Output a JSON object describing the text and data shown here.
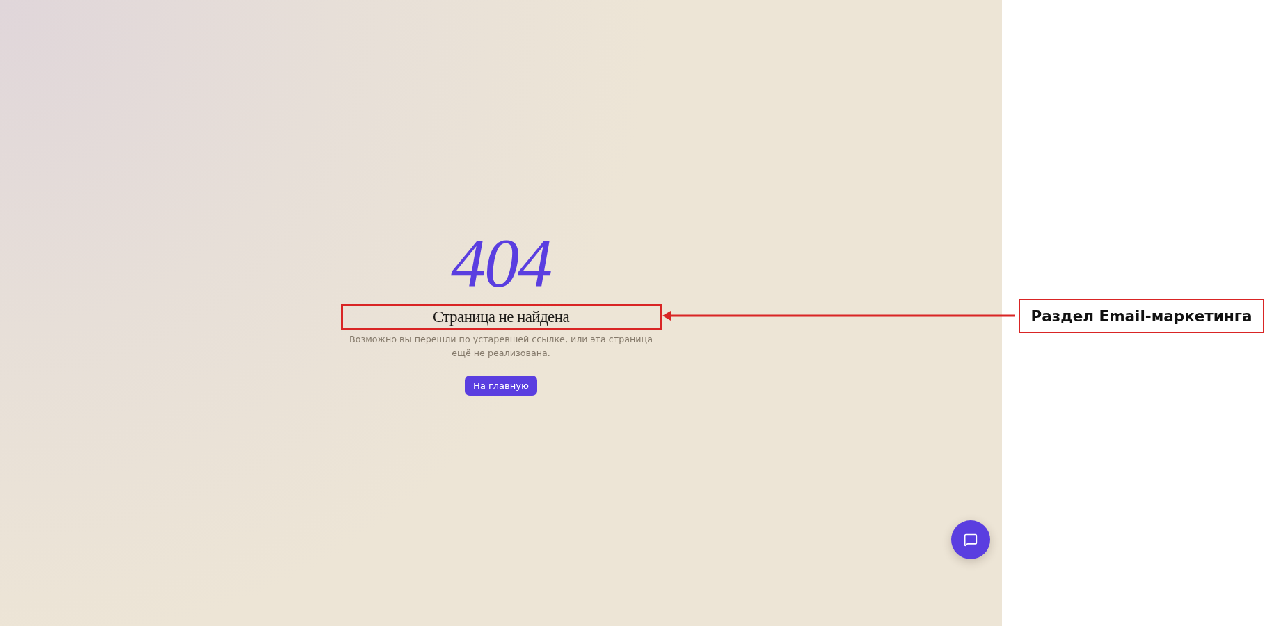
{
  "error_page": {
    "code": "404",
    "title": "Страница не найдена",
    "message": "Возможно вы перешли по устаревшей ссылке, или эта страница ещё не реализована.",
    "home_button": "На главную"
  },
  "callout": {
    "label": "Раздел Email-маркетинга"
  }
}
